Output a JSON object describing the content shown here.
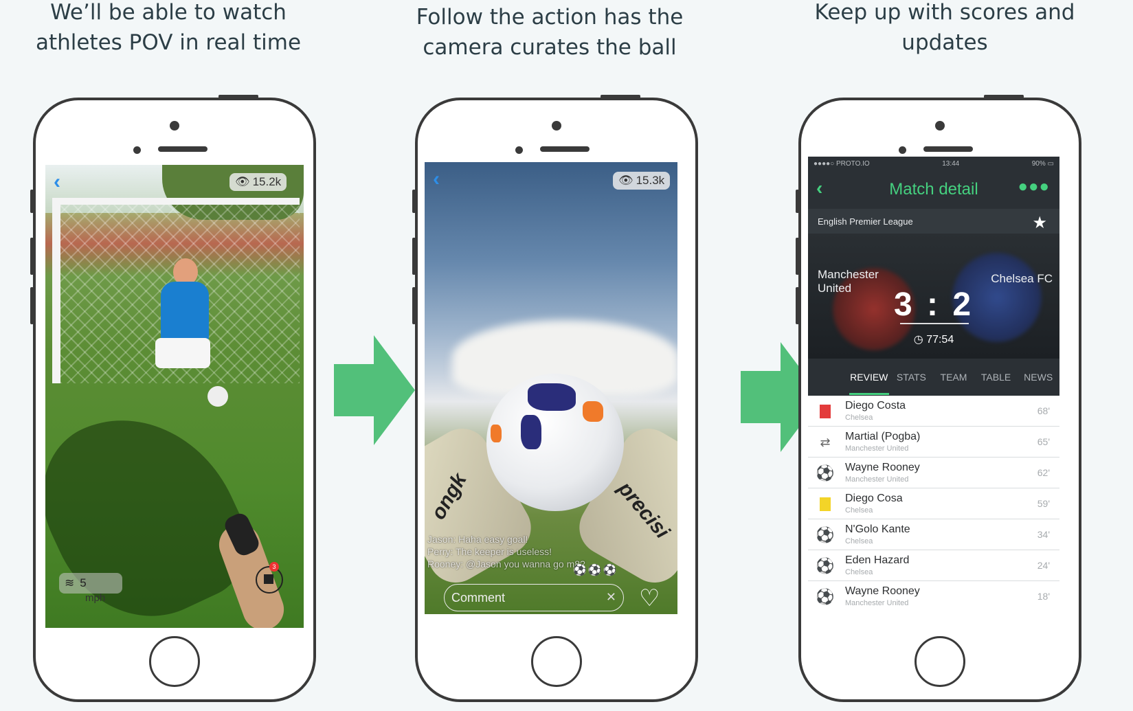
{
  "headings": {
    "left": "We’ll be able to watch athletes POV in real time",
    "middle": "Follow the action has the camera curates the ball",
    "right": "Keep up with scores and updates"
  },
  "colors": {
    "accent_green": "#45d07f",
    "arrow_green": "#52c07a",
    "nav_blue": "#2d8ee8"
  },
  "phone1": {
    "back_icon": "chevron-left-icon",
    "viewers": "15.2k",
    "speed_value": "5",
    "speed_unit": "mph",
    "record_badge": "3"
  },
  "phone2": {
    "back_icon": "chevron-left-icon",
    "viewers": "15.3k",
    "glove_left_text": "ongk",
    "glove_right_text": "precisi",
    "chat": [
      "Jason: Haha easy goal!",
      "Perry: The keeper is useless!",
      "Rooney: @Jason you wanna go m8?"
    ],
    "comment_placeholder": "Comment",
    "clear_icon": "close-icon",
    "like_icon": "heart-icon"
  },
  "phone3": {
    "status": {
      "carrier": "●●●●○ PROTO.IO",
      "time": "13:44",
      "battery": "90%"
    },
    "nav": {
      "title": "Match detail"
    },
    "league": "English Premier League",
    "home_team": "Manchester United",
    "away_team": "Chelsea FC",
    "score": "3 : 2",
    "clock": "77:54",
    "tabs": [
      "REVIEW",
      "STATS",
      "TEAM",
      "TABLE",
      "NEWS"
    ],
    "active_tab": "REVIEW",
    "events": [
      {
        "icon": "red-card-icon",
        "name": "Diego Costa",
        "club": "Chelsea",
        "minute": "68'"
      },
      {
        "icon": "substitution-icon",
        "name": "Martial (Pogba)",
        "club": "Manchester United",
        "minute": "65'"
      },
      {
        "icon": "goal-ball-icon",
        "name": "Wayne Rooney",
        "club": "Manchester United",
        "minute": "62'"
      },
      {
        "icon": "yellow-card-icon",
        "name": "Diego Cosa",
        "club": "Chelsea",
        "minute": "59'"
      },
      {
        "icon": "goal-ball-icon",
        "name": "N'Golo Kante",
        "club": "Chelsea",
        "minute": "34'"
      },
      {
        "icon": "goal-ball-icon",
        "name": "Eden Hazard",
        "club": "Chelsea",
        "minute": "24'"
      },
      {
        "icon": "goal-ball-icon",
        "name": "Wayne Rooney",
        "club": "Manchester United",
        "minute": "18'"
      }
    ]
  }
}
